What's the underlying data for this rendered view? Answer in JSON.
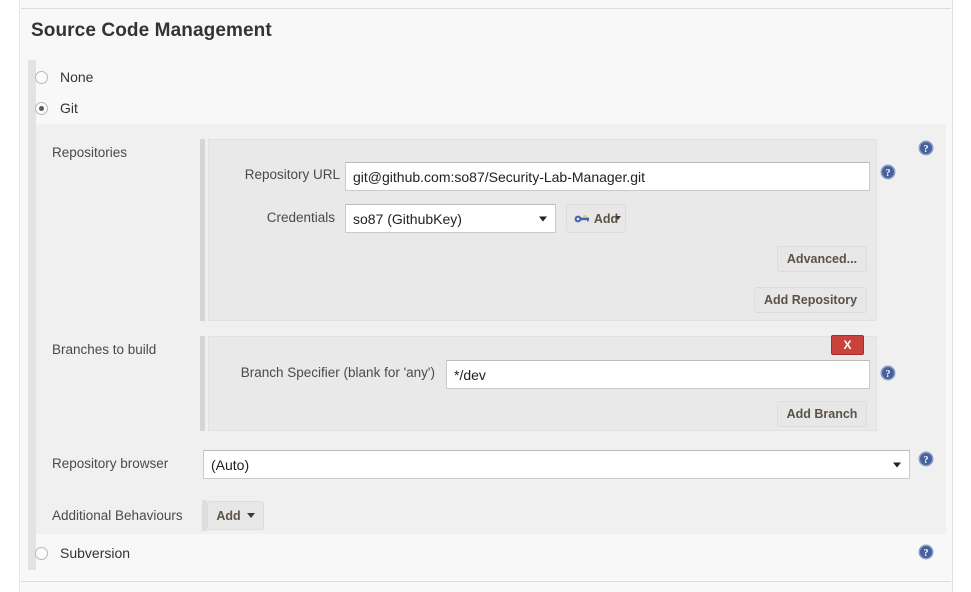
{
  "section": {
    "title": "Source Code Management"
  },
  "scm_options": [
    {
      "label": "None",
      "selected": false
    },
    {
      "label": "Git",
      "selected": true
    },
    {
      "label": "Subversion",
      "selected": false
    }
  ],
  "git": {
    "repositories": {
      "label": "Repositories",
      "repository_url": {
        "label": "Repository URL",
        "value": "git@github.com:so87/Security-Lab-Manager.git",
        "placeholder": ""
      },
      "credentials": {
        "label": "Credentials",
        "value": "so87 (GithubKey)"
      },
      "add_credentials_button": "Add",
      "advanced_button": "Advanced...",
      "add_repository_button": "Add Repository"
    },
    "branches": {
      "label": "Branches to build",
      "delete_button": "X",
      "branch_specifier": {
        "label": "Branch Specifier (blank for 'any')",
        "value": "*/dev",
        "placeholder": ""
      },
      "add_branch_button": "Add Branch"
    },
    "repository_browser": {
      "label": "Repository browser",
      "value": "(Auto)"
    },
    "additional_behaviours": {
      "label": "Additional Behaviours",
      "add_button": "Add"
    }
  },
  "icons": {
    "help": "help-icon",
    "key": "key-icon",
    "caret": "chevron-down-icon"
  },
  "colors": {
    "help_blue": "#46629e",
    "danger_red": "#c9433c",
    "panel_gray": "#f0f0f0",
    "group_gray": "#e9e9e9",
    "button_gray": "#e7e7e7"
  }
}
